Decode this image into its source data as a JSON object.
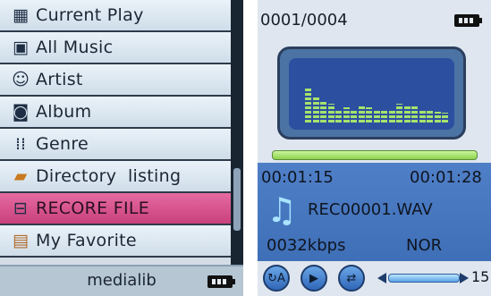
{
  "library_screen": {
    "title": "medialib",
    "menu": [
      {
        "label": "Current Play",
        "icon": "now-playing-icon",
        "selected": false
      },
      {
        "label": "All Music",
        "icon": "music-library-icon",
        "selected": false
      },
      {
        "label": "Artist",
        "icon": "artist-icon",
        "selected": false
      },
      {
        "label": "Album",
        "icon": "album-icon",
        "selected": false
      },
      {
        "label": "Genre",
        "icon": "genre-icon",
        "selected": false
      },
      {
        "label": "Directory  listing",
        "icon": "folder-icon",
        "selected": false
      },
      {
        "label": "RECORE FILE",
        "icon": "record-file-icon",
        "selected": true
      },
      {
        "label": "My Favorite",
        "icon": "favorite-icon",
        "selected": false
      }
    ],
    "battery": "battery-full-icon"
  },
  "player_screen": {
    "track_counter": "0001/0004",
    "elapsed": "00:01:15",
    "total": "00:01:28",
    "filename": "REC00001.WAV",
    "bitrate": "0032kbps",
    "eq_mode": "NOR",
    "volume": "15",
    "battery": "battery-full-icon",
    "controls": [
      "repeat-ab-icon",
      "play-icon",
      "shuffle-icon"
    ],
    "equalizer_levels": [
      0.55,
      0.42,
      0.35,
      0.3,
      0.22,
      0.24,
      0.22,
      0.25,
      0.24,
      0.22,
      0.2,
      0.18,
      0.3,
      0.28,
      0.26,
      0.2,
      0.18,
      0.17,
      0.16
    ]
  },
  "colors": {
    "selection": "#d9558f",
    "info_panel": "#4a7bc2",
    "eq_bars": "#a7e26c"
  }
}
